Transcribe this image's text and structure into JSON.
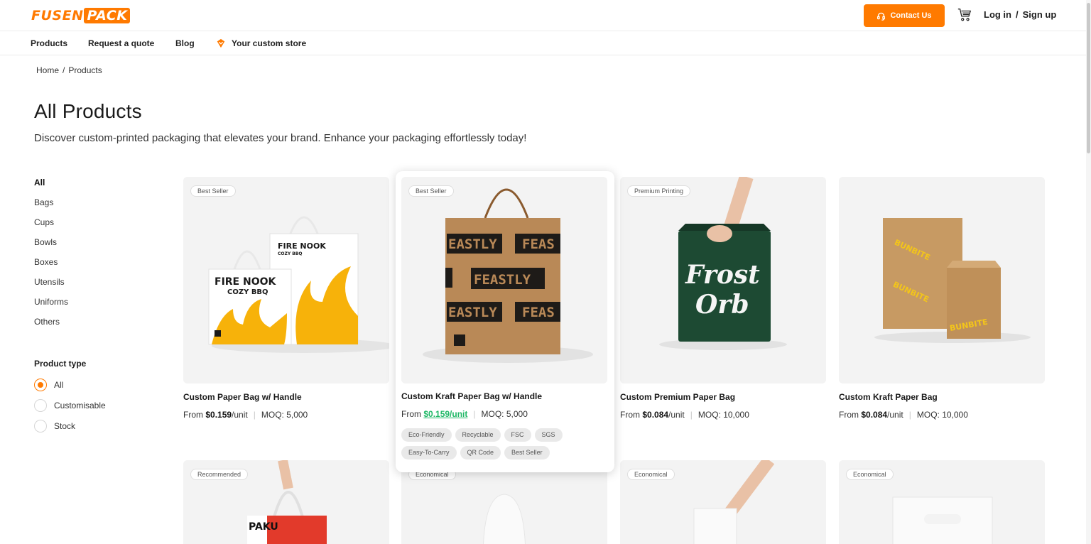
{
  "brand": {
    "logo_left": "FUSEN",
    "logo_right": "PACK",
    "accent": "#ff7a00"
  },
  "header": {
    "contact_label": "Contact Us",
    "login_label": "Log in",
    "divider": "/",
    "signup_label": "Sign up"
  },
  "nav": {
    "items": [
      "Products",
      "Request a quote",
      "Blog",
      "Your custom store"
    ]
  },
  "breadcrumb": {
    "home": "Home",
    "sep": "/",
    "current": "Products"
  },
  "page": {
    "title": "All Products",
    "subtitle": "Discover custom-printed packaging that elevates your brand. Enhance your packaging effortlessly today!"
  },
  "sidebar": {
    "categories": [
      "All",
      "Bags",
      "Cups",
      "Bowls",
      "Boxes",
      "Utensils",
      "Uniforms",
      "Others"
    ],
    "product_type_title": "Product type",
    "product_types": [
      "All",
      "Customisable",
      "Stock"
    ]
  },
  "products": [
    {
      "badge": "Best Seller",
      "name": "Custom Paper Bag w/ Handle",
      "from": "From ",
      "price": "$0.159",
      "unit": "/unit",
      "moq": "MOQ: 5,000",
      "art": "FIRE NOOK",
      "art_sub": "COZY BBQ"
    },
    {
      "badge": "Best Seller",
      "name": "Custom Kraft Paper Bag w/ Handle",
      "from": "From ",
      "price": "$0.159",
      "unit": "/unit",
      "moq": "MOQ: 5,000",
      "art": "FEASTLY",
      "tags": [
        "Eco-Friendly",
        "Recyclable",
        "FSC",
        "SGS",
        "Easy-To-Carry",
        "QR Code",
        "Best Seller"
      ]
    },
    {
      "badge": "Premium Printing",
      "name": "Custom Premium Paper Bag",
      "from": "From ",
      "price": "$0.084",
      "unit": "/unit",
      "moq": "MOQ: 10,000",
      "art": "Frost Orb"
    },
    {
      "badge": "",
      "name": "Custom Kraft Paper Bag",
      "from": "From ",
      "price": "$0.084",
      "unit": "/unit",
      "moq": "MOQ: 10,000",
      "art": "BUNBITE"
    },
    {
      "badge": "Recommended",
      "art": "PAKU"
    },
    {
      "badge": "Economical"
    },
    {
      "badge": "Economical"
    },
    {
      "badge": "Economical"
    }
  ]
}
